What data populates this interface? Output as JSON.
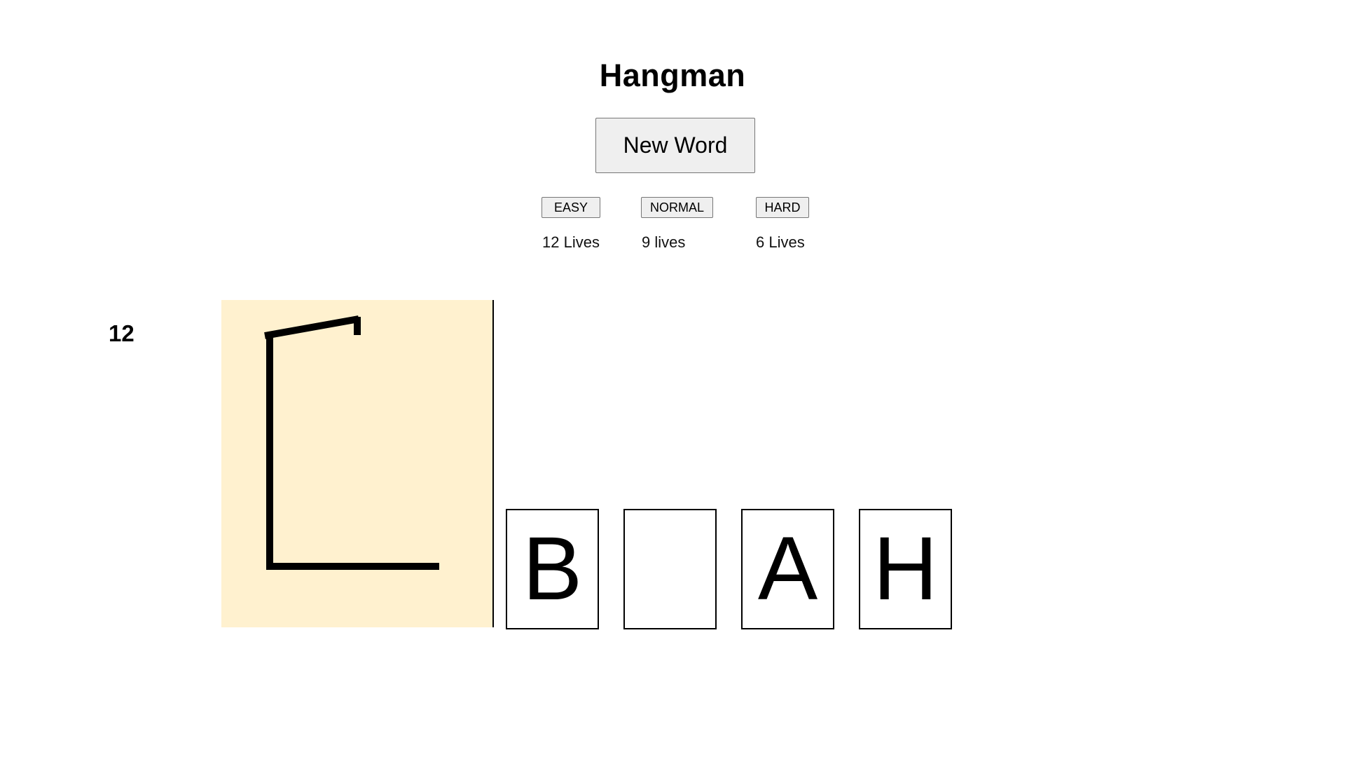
{
  "title": "Hangman",
  "new_word_label": "New Word",
  "difficulty": [
    {
      "label": "EASY",
      "lives_text": "12 Lives"
    },
    {
      "label": "NORMAL",
      "lives_text": "9 lives"
    },
    {
      "label": "HARD",
      "lives_text": "6 Lives"
    }
  ],
  "lives_remaining": "12",
  "word_tiles": [
    "B",
    "",
    "A",
    "H"
  ],
  "colors": {
    "canvas_background": "#fff1cf",
    "gallows": "#000000",
    "button_background": "#efefef"
  }
}
